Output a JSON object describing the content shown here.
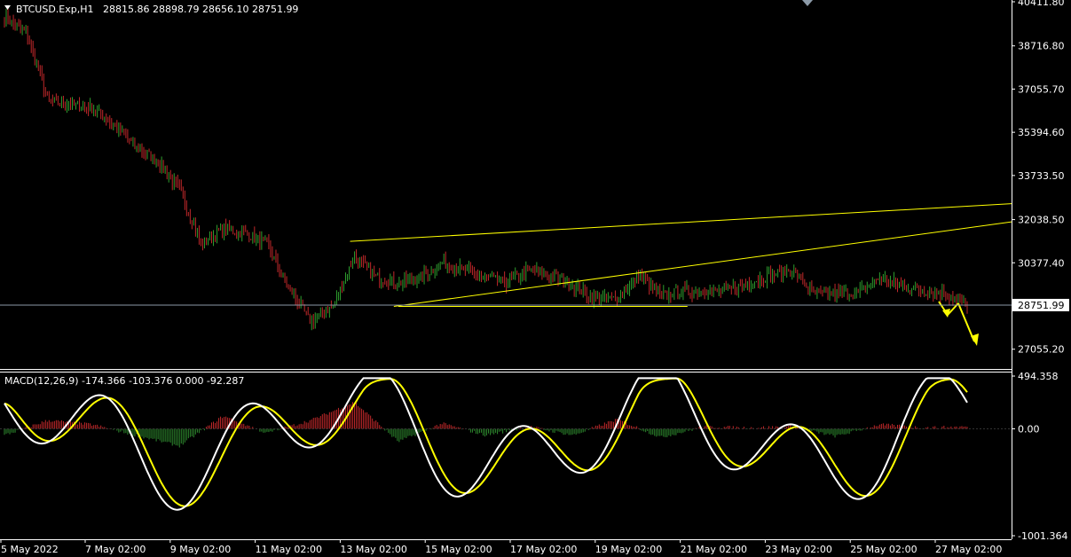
{
  "header": {
    "symbol": "BTCUSD.Exp,H1",
    "ohlc": "28815.86 28898.79 28656.10 28751.99"
  },
  "indicator": {
    "label": "MACD(12,26,9) -174.366 -103.376 0.000 -92.287",
    "axis_labels": [
      "494.358",
      "0.00",
      "-1001.364"
    ],
    "ylim": [
      -1001.364,
      494.358
    ]
  },
  "price_axis": {
    "labels": [
      "40411.80",
      "38716.80",
      "37055.70",
      "35394.60",
      "33733.50",
      "32038.50",
      "30377.40",
      "27055.20"
    ],
    "current_price": "28751.99",
    "ylim": [
      26500,
      40411.8
    ]
  },
  "time_axis": {
    "labels": [
      "5 May 2022",
      "7 May 02:00",
      "9 May 02:00",
      "11 May 02:00",
      "13 May 02:00",
      "15 May 02:00",
      "17 May 02:00",
      "19 May 02:00",
      "21 May 02:00",
      "23 May 02:00",
      "25 May 02:00",
      "27 May 02:00"
    ]
  },
  "colors": {
    "background": "#000000",
    "bull_candle": "#2e9e2e",
    "bear_candle": "#c0282a",
    "trendline": "#ffff00",
    "macd_line": "#ffffff",
    "signal_line": "#ffff00",
    "hist_positive": "#c0282a",
    "hist_negative": "#2e8a2e",
    "grid_line": "#8c9aa8",
    "axis_text": "#ffffff"
  },
  "chart_data": {
    "type": "candlestick",
    "timeframe": "H1",
    "x": [
      "5 May",
      "5 May 12:00",
      "6 May",
      "6 May 12:00",
      "7 May",
      "7 May 12:00",
      "8 May",
      "8 May 12:00",
      "9 May",
      "9 May 12:00",
      "10 May",
      "10 May 12:00",
      "11 May",
      "11 May 12:00",
      "12 May",
      "12 May 12:00",
      "13 May",
      "13 May 12:00",
      "14 May",
      "14 May 12:00",
      "15 May",
      "15 May 12:00",
      "16 May",
      "16 May 12:00",
      "17 May",
      "17 May 12:00",
      "18 May",
      "18 May 12:00",
      "19 May",
      "19 May 12:00",
      "20 May",
      "20 May 12:00",
      "21 May",
      "21 May 12:00",
      "22 May",
      "22 May 12:00",
      "23 May",
      "23 May 12:00",
      "24 May",
      "24 May 12:00",
      "25 May",
      "25 May 12:00",
      "26 May",
      "26 May 12:00",
      "27 May"
    ],
    "close": [
      39800,
      39200,
      36600,
      36500,
      36300,
      35700,
      34800,
      34300,
      33200,
      31100,
      31700,
      31500,
      31100,
      29400,
      28100,
      28700,
      30600,
      29800,
      29600,
      29800,
      30400,
      30100,
      29800,
      29600,
      30100,
      29900,
      29500,
      29000,
      29000,
      29900,
      29100,
      29300,
      29300,
      29300,
      29600,
      29900,
      30100,
      29200,
      29200,
      29200,
      29800,
      29500,
      29300,
      29200,
      28752
    ],
    "macd_hist_x": [
      "5 May",
      "6 May",
      "7 May",
      "8 May",
      "9 May",
      "10 May",
      "11 May",
      "12 May",
      "13 May",
      "14 May",
      "15 May",
      "16 May",
      "17 May",
      "18 May",
      "19 May",
      "20 May",
      "21 May",
      "22 May",
      "23 May",
      "24 May",
      "25 May",
      "26 May",
      "27 May"
    ],
    "macd_hist": [
      -60,
      80,
      40,
      -60,
      -160,
      120,
      -40,
      80,
      250,
      -120,
      50,
      -60,
      20,
      -60,
      90,
      -80,
      20,
      10,
      20,
      -70,
      40,
      10,
      20
    ],
    "annotations": [
      {
        "type": "trendline",
        "from": {
          "x": "13 May",
          "y": 31200
        },
        "to": {
          "x": "27 May",
          "y": 32650
        }
      },
      {
        "type": "trendline",
        "from": {
          "x": "14 May",
          "y": 28700
        },
        "to": {
          "x": "27 May",
          "y": 31950
        }
      },
      {
        "type": "hline",
        "y": 28700,
        "from": "14 May",
        "to": "20 May"
      },
      {
        "type": "hline",
        "y": 28751.99,
        "label": "28751.99"
      }
    ]
  }
}
